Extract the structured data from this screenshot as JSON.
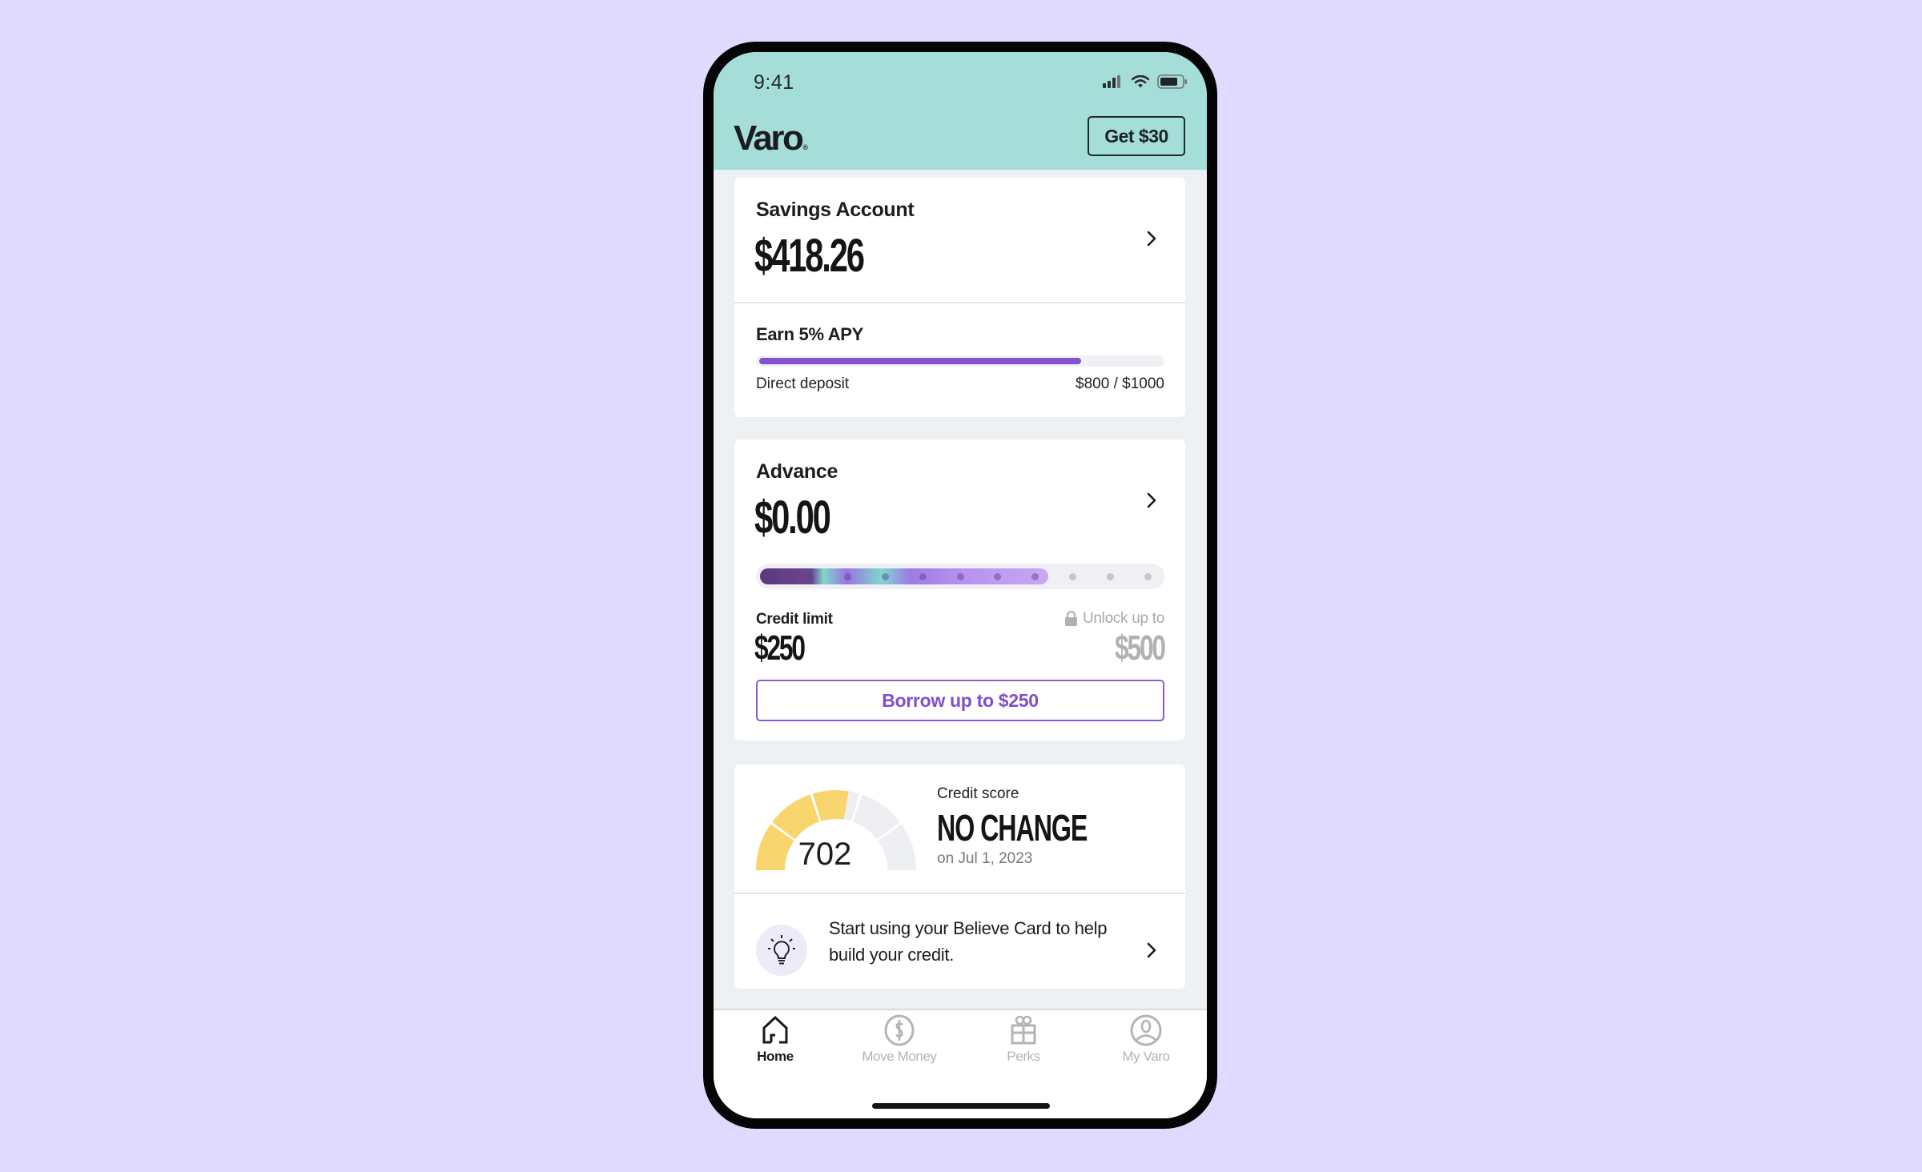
{
  "status_bar": {
    "time": "9:41",
    "icons": [
      "signal-icon",
      "wifi-icon",
      "battery-icon"
    ]
  },
  "header": {
    "logo": "Varo",
    "logo_mark": "®",
    "promo_button": "Get $30",
    "background": "#A5DDD8"
  },
  "savings": {
    "title": "Savings Account",
    "balance": "$418.26",
    "apy_title": "Earn 5% APY",
    "progress_label": "Direct deposit",
    "progress_value_text": "$800 / $1000",
    "progress_fraction": 0.8,
    "accent": "#8452D0"
  },
  "advance": {
    "title": "Advance",
    "balance": "$0.00",
    "tier_progress": {
      "filled_steps": 8,
      "total_steps": 11
    },
    "credit_limit_label": "Credit limit",
    "credit_limit": "$250",
    "unlock_label": "Unlock up to",
    "unlock_amount": "$500",
    "borrow_button": "Borrow up to $250",
    "accent": "#8A5BD4"
  },
  "credit": {
    "score": "702",
    "gauge_fill_fraction": 0.55,
    "gauge_segments": 5,
    "label": "Credit score",
    "status": "NO CHANGE",
    "date": "on Jul 1, 2023",
    "gauge_color": "#F9D56E",
    "tip": "Start using your Believe Card to help build your credit."
  },
  "nav": {
    "items": [
      {
        "label": "Home",
        "icon": "home-icon",
        "active": true
      },
      {
        "label": "Move Money",
        "icon": "dollar-circle-icon",
        "active": false
      },
      {
        "label": "Perks",
        "icon": "gift-icon",
        "active": false
      },
      {
        "label": "My Varo",
        "icon": "user-circle-icon",
        "active": false
      }
    ]
  }
}
